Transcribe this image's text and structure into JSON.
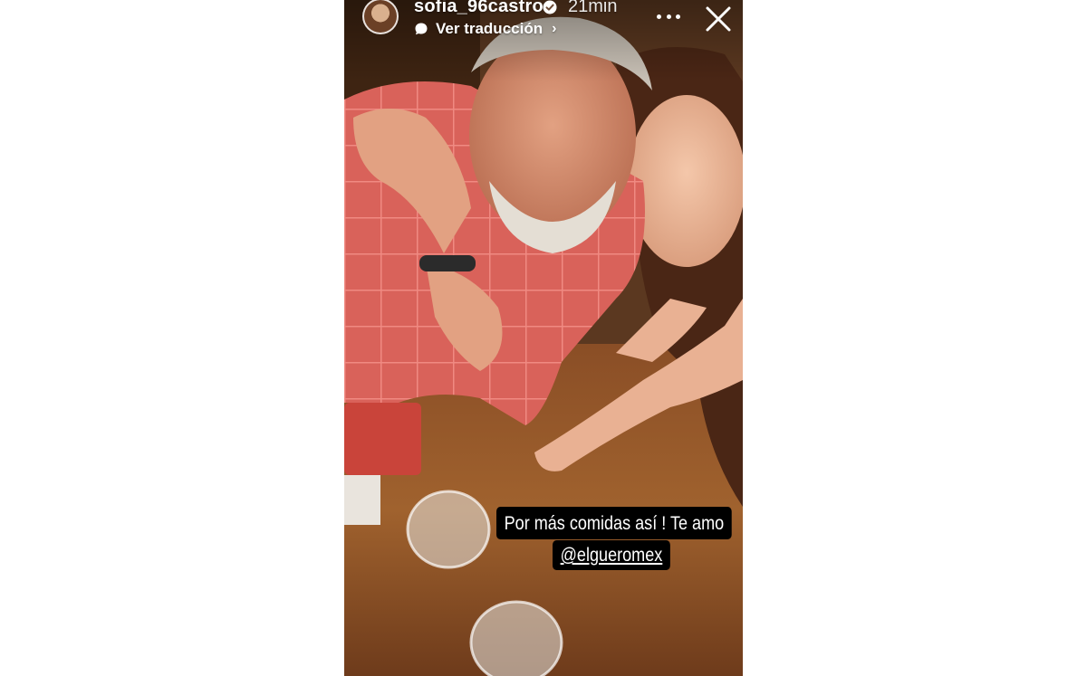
{
  "story": {
    "username": "sofia_96castro",
    "time_ago": "21min",
    "translate_label": "Ver traducción",
    "caption_line1": "Por más comidas así ! Te amo",
    "caption_mention": "@elgueromex"
  },
  "icons": {
    "verified": "verified-badge-icon",
    "translate": "speech-bubble-icon",
    "more": "more-options-icon",
    "close": "close-icon"
  },
  "colors": {
    "caption_bg": "#000000",
    "caption_text": "#ffffff",
    "page_bg": "#ffffff"
  }
}
